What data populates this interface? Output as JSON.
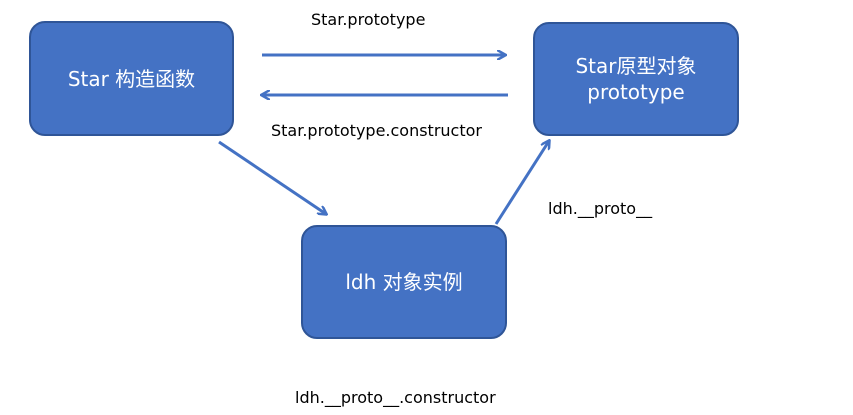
{
  "nodes": {
    "constructor": {
      "text": "Star 构造函数"
    },
    "prototype": {
      "line1": "Star原型对象",
      "line2": "prototype"
    },
    "instance": {
      "text": "ldh 对象实例"
    }
  },
  "edges": {
    "constructor_to_prototype": "Star.prototype",
    "prototype_to_constructor": "Star.prototype.constructor",
    "instance_to_prototype": "ldh.__proto__",
    "instance_proto_constructor": "ldh.__proto__.constructor"
  },
  "colors": {
    "box_fill": "#4472c4",
    "box_border": "#2f5597",
    "arrow": "#4472c4",
    "text": "#000000"
  }
}
